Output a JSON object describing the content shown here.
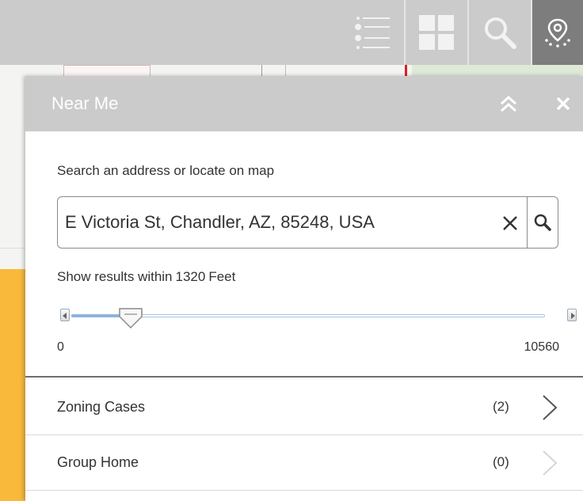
{
  "toolbar": {
    "buttons": [
      {
        "icon": "layer-list-icon"
      },
      {
        "icon": "grid-icon"
      },
      {
        "icon": "search-icon"
      },
      {
        "icon": "near-me-icon",
        "active": true
      }
    ]
  },
  "panel": {
    "title": "Near Me",
    "search_label": "Search an address or locate on map",
    "search_value": "E Victoria St, Chandler, AZ, 85248, USA",
    "range_label": "Show results within",
    "range_value": "1320",
    "range_unit": "Feet",
    "slider": {
      "min": "0",
      "max": "10560",
      "value_fraction": 0.125
    },
    "results": [
      {
        "name": "Zoning Cases",
        "count": "(2)",
        "enabled": true
      },
      {
        "name": "Group Home",
        "count": "(0)",
        "enabled": false
      }
    ]
  },
  "colors": {
    "toolbar_bg": "#cbcbcb",
    "active_tool_bg": "#7d7d7d",
    "panel_header_bg": "#cbcbcb",
    "accent_orange": "#f9b93b"
  }
}
